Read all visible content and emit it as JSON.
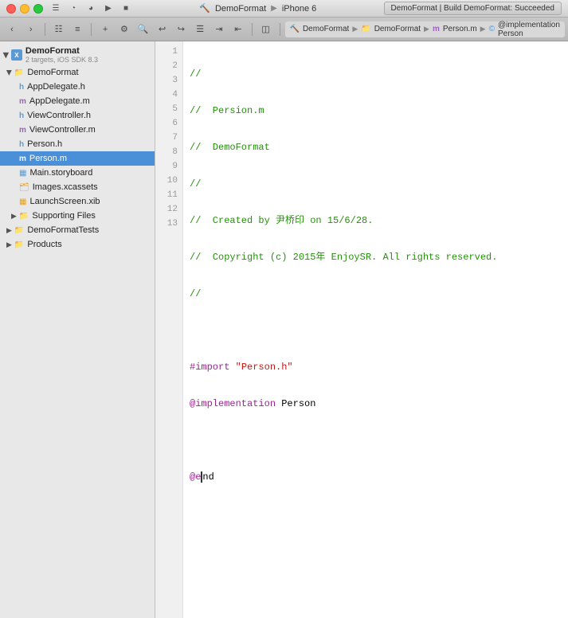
{
  "titlebar": {
    "app_name": "DemoFormat",
    "device": "iPhone 6",
    "build_status": "DemoFormat  |  Build DemoFormat: Succeeded"
  },
  "toolbar": {
    "breadcrumb": [
      "DemoFormat",
      "DemoFormat",
      "Person.m",
      "@implementation Person"
    ]
  },
  "sidebar": {
    "project": {
      "name": "DemoFormat",
      "subtitle": "2 targets, iOS SDK 8.3"
    },
    "items": [
      {
        "name": "DemoFormat",
        "type": "folder",
        "level": 1,
        "open": true
      },
      {
        "name": "AppDelegate.h",
        "type": "h",
        "level": 2
      },
      {
        "name": "AppDelegate.m",
        "type": "m",
        "level": 2
      },
      {
        "name": "ViewController.h",
        "type": "h",
        "level": 2
      },
      {
        "name": "ViewController.m",
        "type": "m",
        "level": 2
      },
      {
        "name": "Person.h",
        "type": "h",
        "level": 2
      },
      {
        "name": "Person.m",
        "type": "m",
        "level": 2,
        "selected": true
      },
      {
        "name": "Main.storyboard",
        "type": "storyboard",
        "level": 2
      },
      {
        "name": "Images.xcassets",
        "type": "xcassets",
        "level": 2
      },
      {
        "name": "LaunchScreen.xib",
        "type": "xib",
        "level": 2
      },
      {
        "name": "Supporting Files",
        "type": "folder",
        "level": 2,
        "open": false
      },
      {
        "name": "DemoFormatTests",
        "type": "folder",
        "level": 1,
        "open": false
      },
      {
        "name": "Products",
        "type": "folder",
        "level": 1,
        "open": false
      }
    ]
  },
  "editor": {
    "lines": [
      {
        "num": 1,
        "tokens": [
          {
            "type": "comment",
            "text": "//"
          }
        ]
      },
      {
        "num": 2,
        "tokens": [
          {
            "type": "comment",
            "text": "//  Persion.m"
          }
        ]
      },
      {
        "num": 3,
        "tokens": [
          {
            "type": "comment",
            "text": "//  DemoFormat"
          }
        ]
      },
      {
        "num": 4,
        "tokens": [
          {
            "type": "comment",
            "text": "//"
          }
        ]
      },
      {
        "num": 5,
        "tokens": [
          {
            "type": "comment",
            "text": "//  Created by 尹桥印 on 15/6/28."
          }
        ]
      },
      {
        "num": 6,
        "tokens": [
          {
            "type": "comment",
            "text": "//  Copyright (c) 2015年 EnjoySR. All rights reserved."
          }
        ]
      },
      {
        "num": 7,
        "tokens": [
          {
            "type": "comment",
            "text": "//"
          }
        ]
      },
      {
        "num": 8,
        "tokens": [
          {
            "type": "plain",
            "text": ""
          }
        ]
      },
      {
        "num": 9,
        "tokens": [
          {
            "type": "import",
            "text": "#import"
          },
          {
            "type": "plain",
            "text": " "
          },
          {
            "type": "string",
            "text": "\"Person.h\""
          }
        ]
      },
      {
        "num": 10,
        "tokens": [
          {
            "type": "keyword",
            "text": "@implementation"
          },
          {
            "type": "plain",
            "text": " Person"
          }
        ]
      },
      {
        "num": 11,
        "tokens": [
          {
            "type": "plain",
            "text": ""
          }
        ]
      },
      {
        "num": 12,
        "tokens": [
          {
            "type": "keyword",
            "text": "@e"
          },
          {
            "type": "cursor",
            "text": ""
          },
          {
            "type": "plain",
            "text": "nd"
          }
        ]
      },
      {
        "num": 13,
        "tokens": [
          {
            "type": "plain",
            "text": ""
          }
        ]
      }
    ]
  }
}
